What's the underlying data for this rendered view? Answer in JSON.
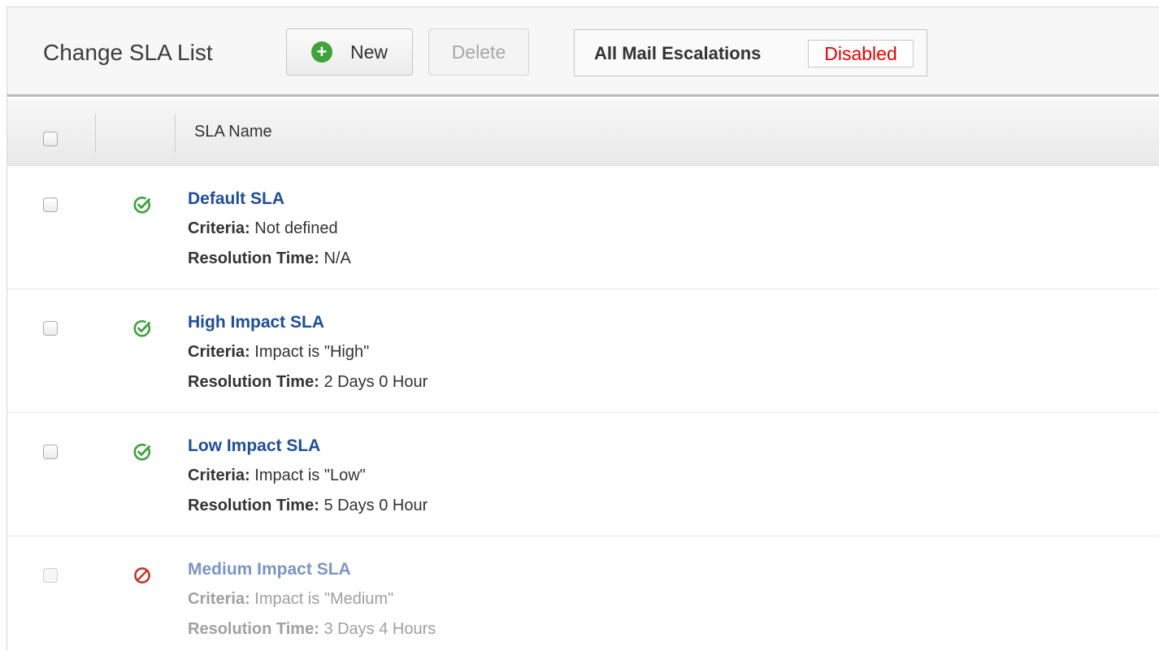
{
  "toolbar": {
    "title": "Change SLA List",
    "new_label": "New",
    "new_icon": "plus-circle-icon",
    "delete_label": "Delete",
    "escalations_label": "All Mail Escalations",
    "escalations_status": "Disabled"
  },
  "table": {
    "column_header": "SLA Name",
    "criteria_label": "Criteria:",
    "resolution_label": "Resolution Time:",
    "rows": [
      {
        "name": "Default SLA",
        "criteria": "Not defined",
        "resolution": "N/A",
        "status": "enabled",
        "status_icon": "check-circle-icon"
      },
      {
        "name": "High Impact SLA",
        "criteria": "Impact is \"High\"",
        "resolution": "2 Days 0 Hour",
        "status": "enabled",
        "status_icon": "check-circle-icon"
      },
      {
        "name": "Low Impact SLA",
        "criteria": "Impact is \"Low\"",
        "resolution": "5 Days 0 Hour",
        "status": "enabled",
        "status_icon": "check-circle-icon"
      },
      {
        "name": "Medium Impact SLA",
        "criteria": "Impact is \"Medium\"",
        "resolution": "3 Days 4 Hours",
        "status": "disabled",
        "status_icon": "prohibited-icon"
      }
    ]
  },
  "colors": {
    "link": "#1f4e96",
    "enabled_icon": "#3fa23a",
    "disabled_icon": "#c0392b",
    "disabled_status_text": "#e60000"
  }
}
